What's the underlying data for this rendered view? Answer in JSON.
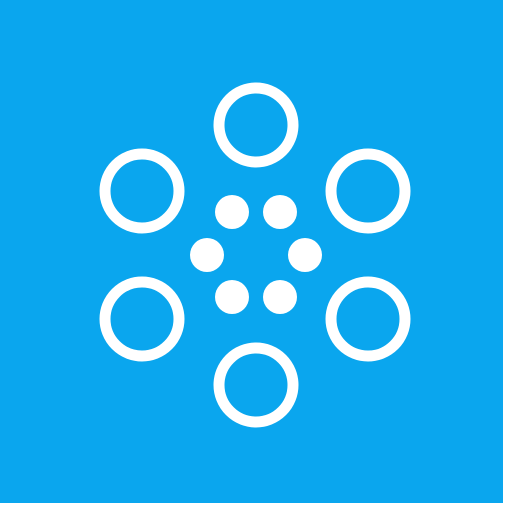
{
  "icon": {
    "name": "dotted-flower-icon",
    "background_color": "#0AA6EE",
    "glyph_color": "#FFFFFF",
    "outer_ring_count": 6,
    "inner_dot_count": 6
  }
}
